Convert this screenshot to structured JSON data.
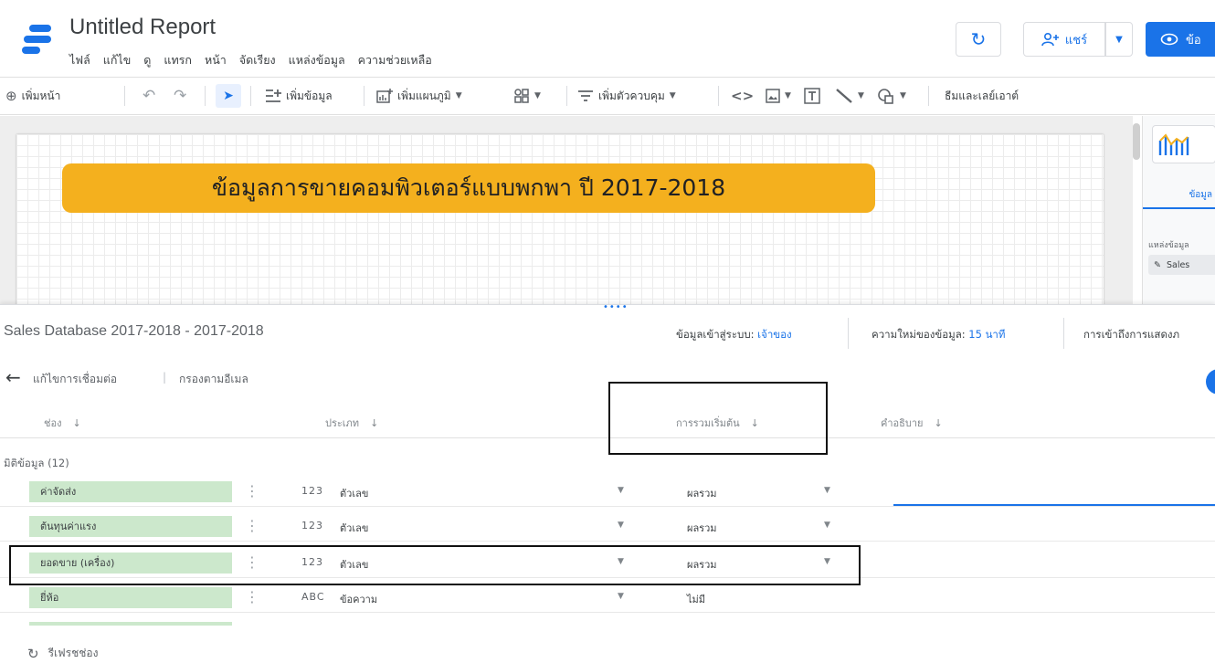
{
  "header": {
    "title": "Untitled Report",
    "menu": [
      "ไฟล์",
      "แก้ไข",
      "ดู",
      "แทรก",
      "หน้า",
      "จัดเรียง",
      "แหล่งข้อมูล",
      "ความช่วยเหลือ"
    ],
    "refresh_icon": "↻",
    "share_label": "แชร์",
    "view_label": "ข้อ"
  },
  "toolbar": {
    "add_page": "เพิ่มหน้า",
    "add_data": "เพิ่มข้อมูล",
    "add_chart": "เพิ่มแผนภูมิ",
    "add_control": "เพิ่มตัวควบคุม",
    "theme_layout": "ธีมและเลย์เอาต์"
  },
  "canvas": {
    "banner_text": "ข้อมูลการขายคอมพิวเตอร์แบบพกพา ปี 2017-2018"
  },
  "right_panel": {
    "tab_label": "ข้อมูล",
    "source_label": "แหล่งข้อมูล",
    "source_name": "Sales"
  },
  "editor": {
    "datasource_name": "Sales Database 2017-2018 - 2017-2018",
    "credentials_label": "ข้อมูลเข้าสู่ระบบ:",
    "credentials_value": "เจ้าของ",
    "freshness_label": "ความใหม่ของข้อมูล:",
    "freshness_value": "15 นาที",
    "access_label": "การเข้าถึงการแสดงภ",
    "edit_connection": "แก้ไขการเชื่อมต่อ",
    "filter_by_email": "กรองตามอีเมล",
    "columns": {
      "field": "ช่อง",
      "type": "ประเภท",
      "aggregation": "การรวมเริ่มต้น",
      "description": "คำอธิบาย"
    },
    "section_label": "มิติข้อมูล (12)",
    "fields": [
      {
        "name": "ค่าจัดส่ง",
        "type_code": "123",
        "type": "ตัวเลข",
        "aggregation": "ผลรวม"
      },
      {
        "name": "ต้นทุนค่าแรง",
        "type_code": "123",
        "type": "ตัวเลข",
        "aggregation": "ผลรวม"
      },
      {
        "name": "ยอดขาย (เครื่อง)",
        "type_code": "123",
        "type": "ตัวเลข",
        "aggregation": "ผลรวม"
      },
      {
        "name": "ยี่ห้อ",
        "type_code": "ABC",
        "type": "ข้อความ",
        "aggregation": "ไม่มี"
      }
    ],
    "refresh_fields": "รีเฟรชช่อง"
  },
  "colors": {
    "accent": "#1a73e8",
    "banner": "#f4b01e",
    "field_chip": "#cce8cc"
  }
}
